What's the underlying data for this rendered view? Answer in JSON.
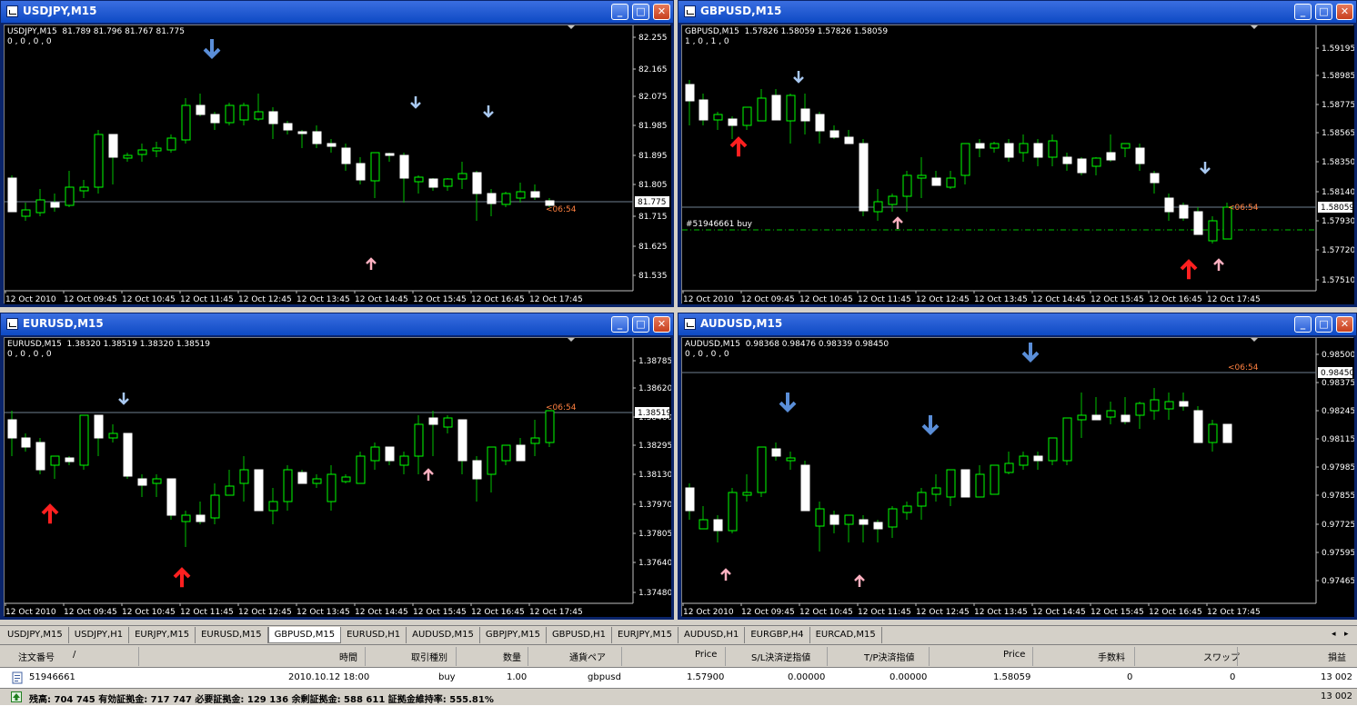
{
  "windows": [
    {
      "title": "USDJPY,M15",
      "info_line1": "USDJPY,M15  81.789 81.796 81.767 81.775",
      "info_line2": "0 , 0 , 0 , 0",
      "y_ticks": [
        "82.255",
        "82.165",
        "82.075",
        "81.985",
        "81.895",
        "81.805",
        "81.715",
        "81.625",
        "81.535"
      ],
      "x_ticks": [
        "12 Oct 2010",
        "12 Oct 09:45",
        "12 Oct 10:45",
        "12 Oct 11:45",
        "12 Oct 12:45",
        "12 Oct 13:45",
        "12 Oct 14:45",
        "12 Oct 15:45",
        "12 Oct 16:45",
        "12 Oct 17:45"
      ],
      "price_label": "81.775",
      "countdown": "<06:54",
      "order_label": ""
    },
    {
      "title": "GBPUSD,M15",
      "info_line1": "GBPUSD,M15  1.57826 1.58059 1.57826 1.58059",
      "info_line2": "1 , 0 , 1 , 0",
      "y_ticks": [
        "1.59195",
        "1.58985",
        "1.58775",
        "1.58565",
        "1.58350",
        "1.58140",
        "1.57930",
        "1.57720",
        "1.57510"
      ],
      "x_ticks": [
        "12 Oct 2010",
        "12 Oct 09:45",
        "12 Oct 10:45",
        "12 Oct 11:45",
        "12 Oct 12:45",
        "12 Oct 13:45",
        "12 Oct 14:45",
        "12 Oct 15:45",
        "12 Oct 16:45",
        "12 Oct 17:45"
      ],
      "price_label": "1.58059",
      "countdown": "<06:54",
      "order_label": "#51946661 buy"
    },
    {
      "title": "EURUSD,M15",
      "info_line1": "EURUSD,M15  1.38320 1.38519 1.38320 1.38519",
      "info_line2": "0 , 0 , 0 , 0",
      "y_ticks": [
        "1.38785",
        "1.38620",
        "1.38460",
        "1.38295",
        "1.38130",
        "1.37970",
        "1.37805",
        "1.37640",
        "1.37480"
      ],
      "x_ticks": [
        "12 Oct 2010",
        "12 Oct 09:45",
        "12 Oct 10:45",
        "12 Oct 11:45",
        "12 Oct 12:45",
        "12 Oct 13:45",
        "12 Oct 14:45",
        "12 Oct 15:45",
        "12 Oct 16:45",
        "12 Oct 17:45"
      ],
      "price_label": "1.38519",
      "countdown": "<06:54",
      "order_label": ""
    },
    {
      "title": "AUDUSD,M15",
      "info_line1": "AUDUSD,M15  0.98368 0.98476 0.98339 0.98450",
      "info_line2": "0 , 0 , 0 , 0",
      "y_ticks": [
        "0.98500",
        "0.98375",
        "0.98245",
        "0.98115",
        "0.97985",
        "0.97855",
        "0.97725",
        "0.97595",
        "0.97465"
      ],
      "x_ticks": [
        "12 Oct 2010",
        "12 Oct 09:45",
        "12 Oct 10:45",
        "12 Oct 11:45",
        "12 Oct 12:45",
        "12 Oct 13:45",
        "12 Oct 14:45",
        "12 Oct 15:45",
        "12 Oct 16:45",
        "12 Oct 17:45"
      ],
      "price_label": "0.98450",
      "countdown": "<06:54",
      "order_label": ""
    }
  ],
  "window_buttons": {
    "minimize": "_",
    "maximize": "□",
    "close": "✕"
  },
  "tabs": [
    "USDJPY,M15",
    "USDJPY,H1",
    "EURJPY,M15",
    "EURUSD,M15",
    "GBPUSD,M15",
    "EURUSD,H1",
    "AUDUSD,M15",
    "GBPJPY,M15",
    "GBPUSD,H1",
    "EURJPY,M15",
    "AUDUSD,H1",
    "EURGBP,H4",
    "EURCAD,M15"
  ],
  "active_tab": "GBPUSD,M15",
  "tab_scroll": {
    "left": "◂",
    "right": "▸"
  },
  "terminal": {
    "headers": [
      "注文番号",
      "/",
      "時間",
      "取引種別",
      "数量",
      "通貨ペア",
      "Price",
      "S/L決済逆指値",
      "T/P決済指値",
      "Price",
      "手数料",
      "スワップ",
      "損益"
    ],
    "order": {
      "id": "51946661",
      "time": "2010.10.12 18:00",
      "type": "buy",
      "volume": "1.00",
      "symbol": "gbpusd",
      "open_price": "1.57900",
      "sl": "0.00000",
      "tp": "0.00000",
      "current_price": "1.58059",
      "commission": "0",
      "swap": "0",
      "profit": "13 002"
    },
    "status_text": "残高: 704 745  有効証拠金: 717 747  必要証拠金: 129 136  余剰証拠金: 588 611  証拠金維持率: 555.81%",
    "status_profit": "13 002"
  },
  "colors": {
    "bull": "#000000",
    "bull_border": "#00ff00",
    "bear": "#ffffff",
    "wick": "#00c000",
    "countdown": "#ff8040",
    "arrow_down": "#a8c8f0",
    "arrow_up": "#ffb0c0",
    "arrow_up_big": "#ff2020",
    "arrow_down_big": "#5a8ed8"
  }
}
